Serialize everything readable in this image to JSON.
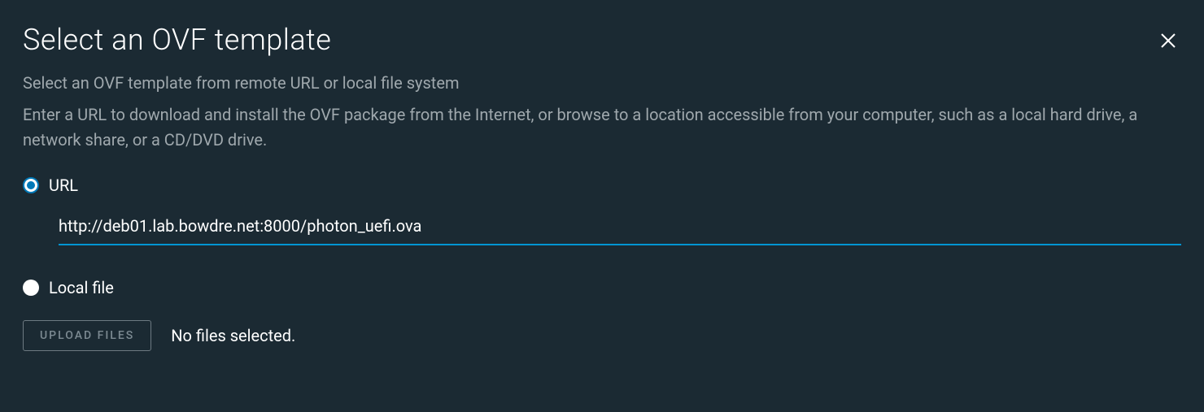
{
  "dialog": {
    "title": "Select an OVF template",
    "subtitle": "Select an OVF template from remote URL or local file system",
    "description": "Enter a URL to download and install the OVF package from the Internet, or browse to a location accessible from your computer, such as a local hard drive, a network share, or a CD/DVD drive."
  },
  "options": {
    "url": {
      "label": "URL",
      "value": "http://deb01.lab.bowdre.net:8000/photon_uefi.ova",
      "selected": true
    },
    "localFile": {
      "label": "Local file",
      "selected": false
    }
  },
  "upload": {
    "buttonLabel": "UPLOAD FILES",
    "status": "No files selected."
  }
}
